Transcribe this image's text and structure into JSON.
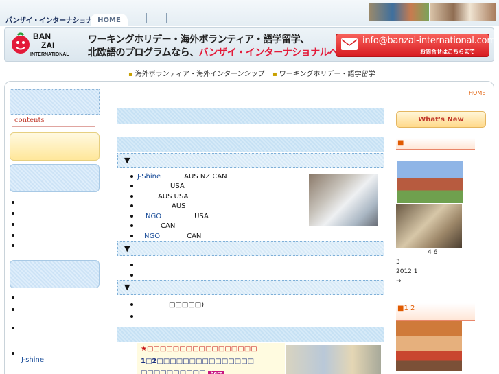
{
  "header": {
    "site_title": "バンザイ・インターナショナル",
    "home_tab": "HOME"
  },
  "banner": {
    "line1": "ワーキングホリデー・海外ボランティア・語学留学、",
    "line2_prefix": "北欧語のプログラムなら、",
    "line2_highlight": "バンザイ・インターナショナルへ！",
    "mail_address": "info@banzai-international.com",
    "mail_sub": "お問合せはこちらまで",
    "logo_colors": {
      "red": "#e31a39",
      "green": "#2e9d3a",
      "yellow": "#f2c12e"
    }
  },
  "subnav": {
    "item1": "海外ボランティア・海外インターンシップ",
    "item2": "ワーキングホリデー・語学留学"
  },
  "breadcrumb": {
    "home": "HOME"
  },
  "left": {
    "contents_label": "contents",
    "jshine": "J-shine"
  },
  "center": {
    "sections": [
      {
        "marker": "▼",
        "items": [
          {
            "link": "J-Shine",
            "text": "AUS NZ CAN"
          },
          {
            "link": "",
            "text": "USA"
          },
          {
            "link": "",
            "text": "AUS USA"
          },
          {
            "link": "",
            "text": "AUS"
          },
          {
            "link": "NGO",
            "text": "USA"
          },
          {
            "link": "",
            "text": "CAN"
          },
          {
            "link": "NGO",
            "text": "CAN"
          }
        ]
      },
      {
        "marker": "▼"
      },
      {
        "marker": "▼",
        "items": [
          {
            "text": "□□□□□)"
          }
        ]
      }
    ],
    "promo": {
      "line1": "★□□□□□□□□□□□□□□□□□",
      "line2": "1□2□□□□□□□□□□□□□□□",
      "line3": "□□□□□□□□□□",
      "badge": "here"
    }
  },
  "right": {
    "whats_new": "What's New",
    "section1_title": "■",
    "text_46": "4 6",
    "text_3": "3",
    "text_2012": "2012 1",
    "arrow": "→",
    "section2_title": "■1 2"
  },
  "colors": {
    "accent_red": "#e31a39",
    "link_blue": "#1a4d99",
    "orange": "#e05a00"
  }
}
